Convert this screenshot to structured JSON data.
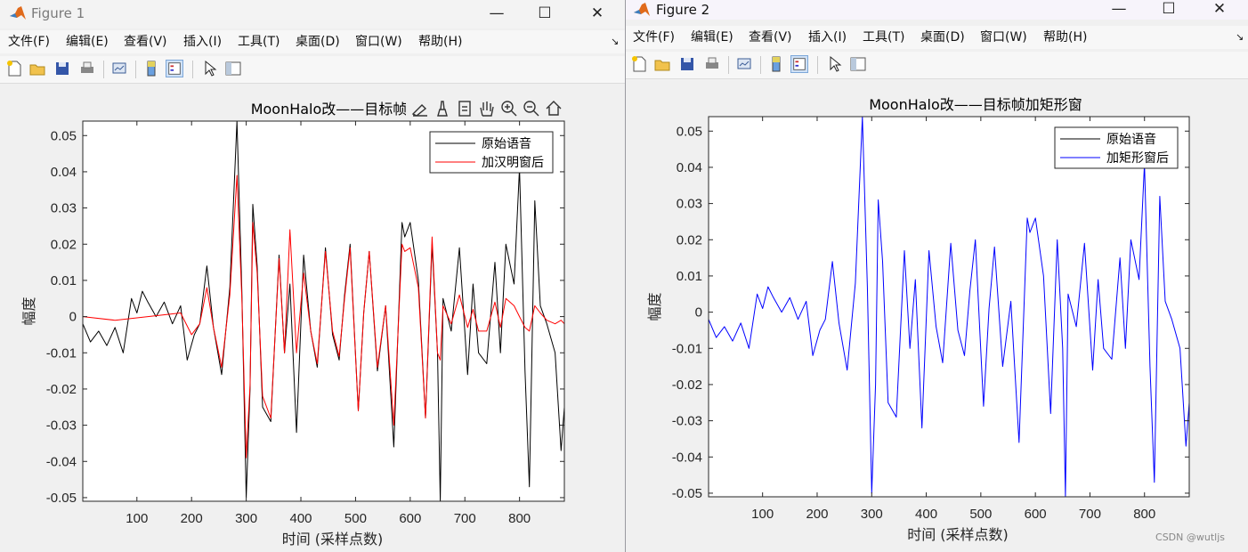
{
  "menu_items": [
    "文件(F)",
    "编辑(E)",
    "查看(V)",
    "插入(I)",
    "工具(T)",
    "桌面(D)",
    "窗口(W)",
    "帮助(H)"
  ],
  "window_controls": {
    "minimize": "—",
    "maximize": "☐",
    "close": "✕",
    "menu_arrow": "↘"
  },
  "watermark": "CSDN @wutljs",
  "windows": [
    {
      "title": "Figure 1",
      "chart_title": "MoonHalo改——目标帧帧加汉",
      "ylabel": "幅度",
      "xlabel": "时间 (采样点数)",
      "legend": [
        "原始语音",
        "加汉明窗后"
      ],
      "axes_tools": [
        "export-icon",
        "brush-icon",
        "datatip-icon",
        "pan-icon",
        "zoom-in-icon",
        "zoom-out-icon",
        "home-icon"
      ]
    },
    {
      "title": "Figure 2",
      "chart_title": "MoonHalo改——目标帧加矩形窗",
      "ylabel": "幅度",
      "xlabel": "时间 (采样点数)",
      "legend": [
        "原始语音",
        "加矩形窗后"
      ]
    }
  ],
  "chart_data": [
    {
      "type": "line",
      "title": "MoonHalo改——目标帧帧加汉",
      "xlabel": "时间 (采样点数)",
      "ylabel": "幅度",
      "xlim": [
        1,
        882
      ],
      "ylim": [
        -0.051,
        0.054
      ],
      "xticks": [
        100,
        200,
        300,
        400,
        500,
        600,
        700,
        800
      ],
      "yticks": [
        -0.05,
        -0.04,
        -0.03,
        -0.02,
        -0.01,
        0,
        0.01,
        0.02,
        0.03,
        0.04,
        0.05
      ],
      "yticklabels": [
        "-0.05",
        "-0.04",
        "-0.03",
        "-0.02",
        "-0.01",
        "0",
        "0.01",
        "0.02",
        "0.03",
        "0.04",
        "0.05"
      ],
      "legend_position": "top-right",
      "series": [
        {
          "name": "原始语音",
          "color": "#000000",
          "x": [
            1,
            15,
            30,
            45,
            60,
            75,
            90,
            100,
            110,
            120,
            135,
            150,
            165,
            180,
            192,
            205,
            215,
            228,
            240,
            255,
            270,
            283,
            292,
            300,
            307,
            312,
            320,
            330,
            345,
            360,
            370,
            380,
            392,
            405,
            418,
            430,
            445,
            458,
            470,
            480,
            490,
            505,
            515,
            525,
            540,
            555,
            570,
            585,
            590,
            600,
            615,
            628,
            640,
            650,
            655,
            660,
            675,
            690,
            705,
            715,
            725,
            740,
            755,
            765,
            775,
            790,
            800,
            810,
            818,
            828,
            838,
            850,
            865,
            876,
            882
          ],
          "y": [
            -0.002,
            -0.007,
            -0.004,
            -0.008,
            -0.003,
            -0.01,
            0.005,
            0.001,
            0.007,
            0.004,
            0.0,
            0.004,
            -0.002,
            0.003,
            -0.012,
            -0.005,
            -0.002,
            0.014,
            -0.003,
            -0.016,
            0.008,
            0.054,
            0.007,
            -0.05,
            -0.02,
            0.031,
            0.014,
            -0.025,
            -0.029,
            0.017,
            -0.01,
            0.009,
            -0.032,
            0.017,
            -0.004,
            -0.014,
            0.019,
            -0.005,
            -0.012,
            0.006,
            0.02,
            -0.026,
            0.001,
            0.018,
            -0.015,
            0.003,
            -0.036,
            0.026,
            0.022,
            0.026,
            0.01,
            -0.028,
            0.02,
            -0.01,
            -0.051,
            0.005,
            -0.004,
            0.019,
            -0.016,
            0.009,
            -0.01,
            -0.013,
            0.015,
            -0.01,
            0.02,
            0.009,
            0.041,
            -0.015,
            -0.047,
            0.032,
            0.003,
            -0.002,
            -0.01,
            -0.037,
            -0.025
          ]
        },
        {
          "name": "加汉明窗后",
          "color": "#ff0000",
          "x": [
            1,
            60,
            120,
            180,
            200,
            215,
            228,
            240,
            255,
            270,
            283,
            292,
            300,
            307,
            312,
            320,
            330,
            345,
            360,
            370,
            380,
            392,
            405,
            418,
            430,
            445,
            458,
            470,
            480,
            490,
            505,
            515,
            525,
            540,
            555,
            570,
            585,
            590,
            600,
            615,
            628,
            640,
            650,
            655,
            660,
            675,
            690,
            705,
            715,
            725,
            740,
            755,
            765,
            775,
            790,
            800,
            810,
            818,
            828,
            838,
            850,
            865,
            876,
            882
          ],
          "y": [
            0.0,
            -0.001,
            0.0,
            0.001,
            -0.005,
            -0.002,
            0.008,
            -0.003,
            -0.014,
            0.006,
            0.039,
            0.005,
            -0.039,
            -0.019,
            0.026,
            0.012,
            -0.022,
            -0.028,
            0.016,
            -0.01,
            0.024,
            -0.01,
            0.012,
            -0.004,
            -0.013,
            0.018,
            -0.004,
            -0.011,
            0.005,
            0.019,
            -0.026,
            0.001,
            0.018,
            -0.014,
            0.003,
            -0.03,
            0.02,
            0.018,
            0.019,
            0.008,
            -0.028,
            0.022,
            -0.01,
            -0.012,
            0.003,
            -0.002,
            0.006,
            -0.003,
            0.002,
            -0.004,
            -0.004,
            0.004,
            -0.003,
            0.005,
            0.003,
            0.0,
            -0.003,
            -0.004,
            0.003,
            0.001,
            -0.001,
            -0.002,
            -0.001,
            -0.002
          ]
        }
      ]
    },
    {
      "type": "line",
      "title": "MoonHalo改——目标帧加矩形窗",
      "xlabel": "时间 (采样点数)",
      "ylabel": "幅度",
      "xlim": [
        1,
        882
      ],
      "ylim": [
        -0.051,
        0.054
      ],
      "xticks": [
        100,
        200,
        300,
        400,
        500,
        600,
        700,
        800
      ],
      "yticks": [
        -0.05,
        -0.04,
        -0.03,
        -0.02,
        -0.01,
        0,
        0.01,
        0.02,
        0.03,
        0.04,
        0.05
      ],
      "yticklabels": [
        "-0.05",
        "-0.04",
        "-0.03",
        "-0.02",
        "-0.01",
        "0",
        "0.01",
        "0.02",
        "0.03",
        "0.04",
        "0.05"
      ],
      "legend_position": "top-right",
      "series": [
        {
          "name": "原始语音",
          "color": "#000000",
          "x": [],
          "y": []
        },
        {
          "name": "加矩形窗后",
          "color": "#0000ff",
          "x": [
            1,
            15,
            30,
            45,
            60,
            75,
            90,
            100,
            110,
            120,
            135,
            150,
            165,
            180,
            192,
            205,
            215,
            228,
            240,
            255,
            270,
            283,
            292,
            300,
            307,
            312,
            320,
            330,
            345,
            360,
            370,
            380,
            392,
            405,
            418,
            430,
            445,
            458,
            470,
            480,
            490,
            505,
            515,
            525,
            540,
            555,
            570,
            585,
            590,
            600,
            615,
            628,
            640,
            650,
            655,
            660,
            675,
            690,
            705,
            715,
            725,
            740,
            755,
            765,
            775,
            790,
            800,
            810,
            818,
            828,
            838,
            850,
            865,
            876,
            882
          ],
          "y": [
            -0.002,
            -0.007,
            -0.004,
            -0.008,
            -0.003,
            -0.01,
            0.005,
            0.001,
            0.007,
            0.004,
            0.0,
            0.004,
            -0.002,
            0.003,
            -0.012,
            -0.005,
            -0.002,
            0.014,
            -0.003,
            -0.016,
            0.008,
            0.054,
            0.007,
            -0.05,
            -0.02,
            0.031,
            0.014,
            -0.025,
            -0.029,
            0.017,
            -0.01,
            0.009,
            -0.032,
            0.017,
            -0.004,
            -0.014,
            0.019,
            -0.005,
            -0.012,
            0.006,
            0.02,
            -0.026,
            0.001,
            0.018,
            -0.015,
            0.003,
            -0.036,
            0.026,
            0.022,
            0.026,
            0.01,
            -0.028,
            0.02,
            -0.01,
            -0.051,
            0.005,
            -0.004,
            0.019,
            -0.016,
            0.009,
            -0.01,
            -0.013,
            0.015,
            -0.01,
            0.02,
            0.009,
            0.041,
            -0.015,
            -0.047,
            0.032,
            0.003,
            -0.002,
            -0.01,
            -0.037,
            -0.025
          ]
        }
      ]
    }
  ]
}
